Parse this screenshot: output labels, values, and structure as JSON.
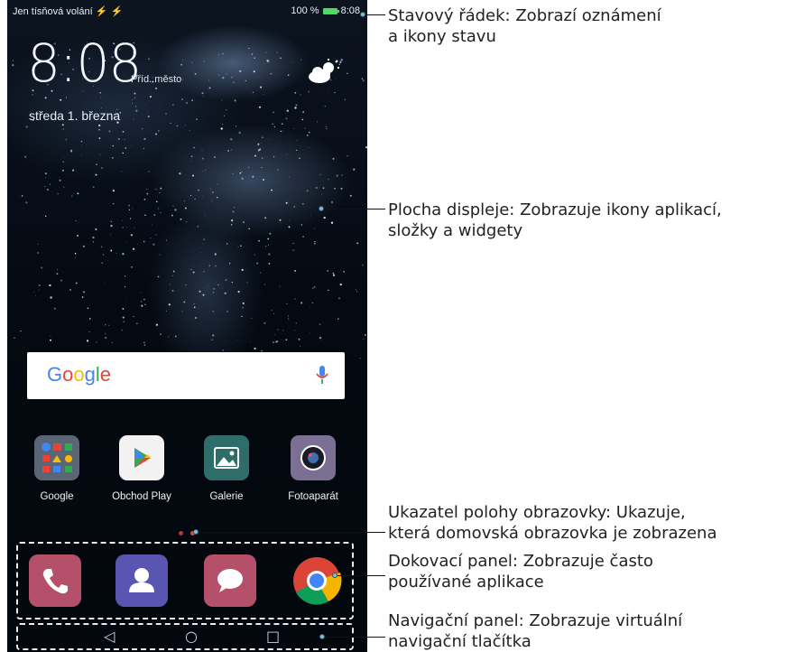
{
  "status_bar": {
    "left_text": "Jen tísňová volání ⚡ ⚡",
    "battery": "100 %",
    "time": "8:08"
  },
  "clock_widget": {
    "time": "8:08",
    "city": "Příd. město",
    "date": "středa 1. března",
    "weather_icon": "partly-cloudy-icon"
  },
  "search": {
    "logo_parts": [
      "G",
      "o",
      "o",
      "g",
      "l",
      "e"
    ],
    "mic_icon": "mic-icon"
  },
  "apps": [
    {
      "label": "Google",
      "icon": "google-folder-icon"
    },
    {
      "label": "Obchod Play",
      "icon": "play-store-icon"
    },
    {
      "label": "Galerie",
      "icon": "gallery-icon"
    },
    {
      "label": "Fotoaparát",
      "icon": "camera-icon"
    }
  ],
  "dock": [
    {
      "icon": "phone-icon",
      "color": "#b4506a"
    },
    {
      "icon": "contacts-icon",
      "color": "#5a55b0"
    },
    {
      "icon": "messages-icon",
      "color": "#b4506a"
    },
    {
      "icon": "chrome-icon",
      "color": "#db4437"
    }
  ],
  "nav_buttons": [
    "◁",
    "○",
    "□"
  ],
  "callouts": [
    {
      "name": "status-bar-callout",
      "lines": [
        "Stavový řádek: Zobrazí oznámení",
        "a ikony stavu"
      ]
    },
    {
      "name": "home-screen-callout",
      "lines": [
        "Plocha displeje: Zobrazuje ikony aplikací,",
        "složky a widgety"
      ]
    },
    {
      "name": "page-indicator-callout",
      "lines": [
        "Ukazatel polohy obrazovky: Ukazuje,",
        "která domovská obrazovka je zobrazena"
      ]
    },
    {
      "name": "dock-callout",
      "lines": [
        "Dokovací panel: Zobrazuje často",
        "používané aplikace"
      ]
    },
    {
      "name": "navbar-callout",
      "lines": [
        "Navigační panel: Zobrazuje virtuální",
        "navigační tlačítka"
      ]
    }
  ],
  "colors": {
    "accent_dot": "#7fbfd6",
    "page_dot_active": "#d03030",
    "page_dot_inactive": "#d85050"
  }
}
